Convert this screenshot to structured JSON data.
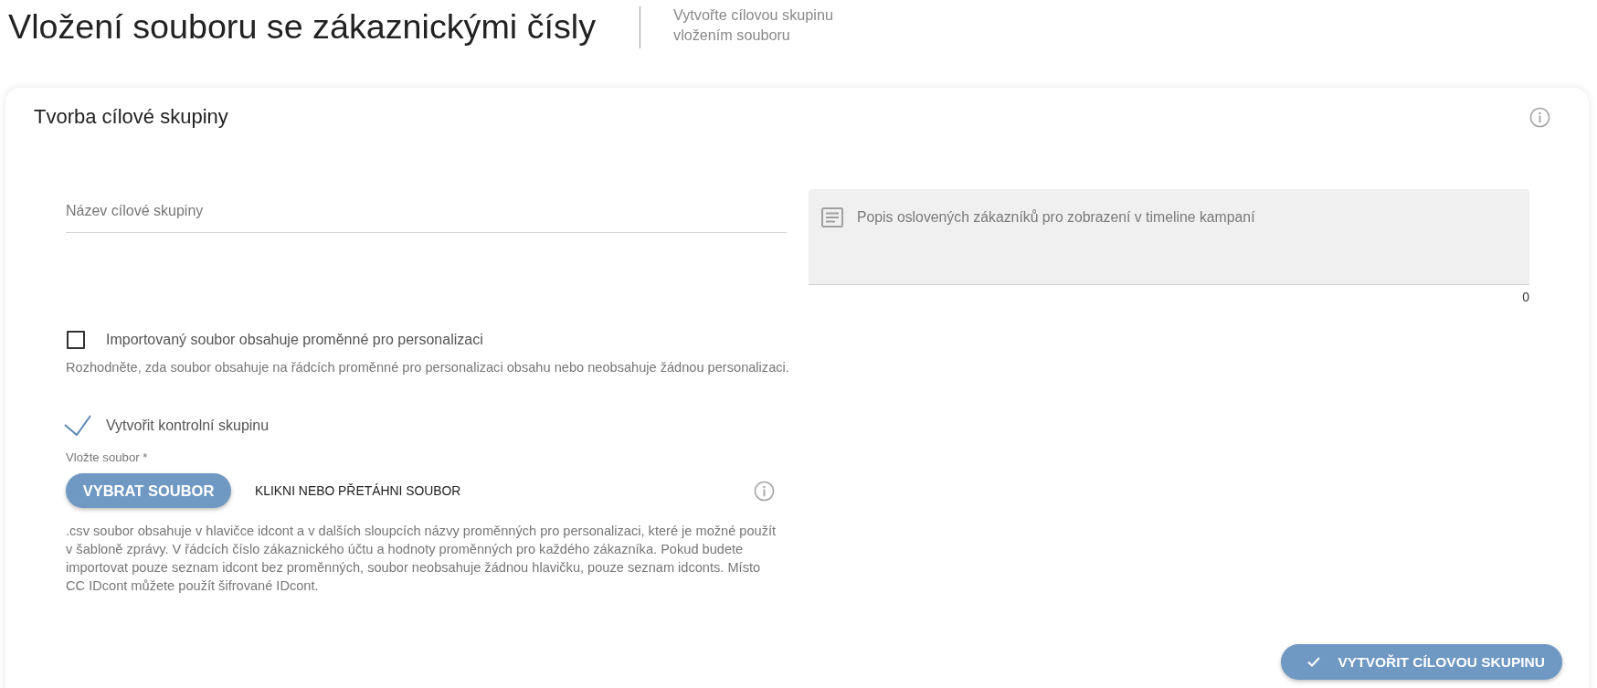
{
  "header": {
    "title": "Vložení souboru se zákaznickými čísly",
    "subtitle": "Vytvořte cílovou skupinu vložením souboru"
  },
  "card": {
    "title": "Tvorba cílové skupiny",
    "name_field": {
      "placeholder": "Název cílové skupiny"
    },
    "description_field": {
      "placeholder": "Popis oslovených zákazníků pro zobrazení v timeline kampaní",
      "counter": "0"
    },
    "options": [
      {
        "label": "Importovaný soubor obsahuje proměnné pro personalizaci",
        "checked": false,
        "hint": "Rozhodněte, zda soubor obsahuje na řádcích proměnné pro personalizaci obsahu nebo neobsahuje žádnou personalizaci."
      },
      {
        "label": "Vytvořit kontrolní skupinu",
        "checked": true
      }
    ],
    "file_upload": {
      "label": "Vložte soubor *",
      "button": "VYBRAT SOUBOR",
      "drop_hint": "KLIKNI NEBO PŘETÁHNI SOUBOR",
      "help": ".csv soubor obsahuje v hlavičce idcont a v dalších sloupcích názvy proměnných pro personalizaci, které je možné použít v šabloně zprávy. V řádcích číslo zákaznického účtu a hodnoty proměnných pro každého zákazníka. Pokud budete importovat pouze seznam idcont bez proměnných, soubor neobsahuje žádnou hlavičku, pouze seznam idconts. Místo CC IDcont můžete použít šifrované IDcont."
    },
    "submit_button": {
      "label": "VYTVOŘIT CÍLOVOU SKUPINU"
    }
  }
}
